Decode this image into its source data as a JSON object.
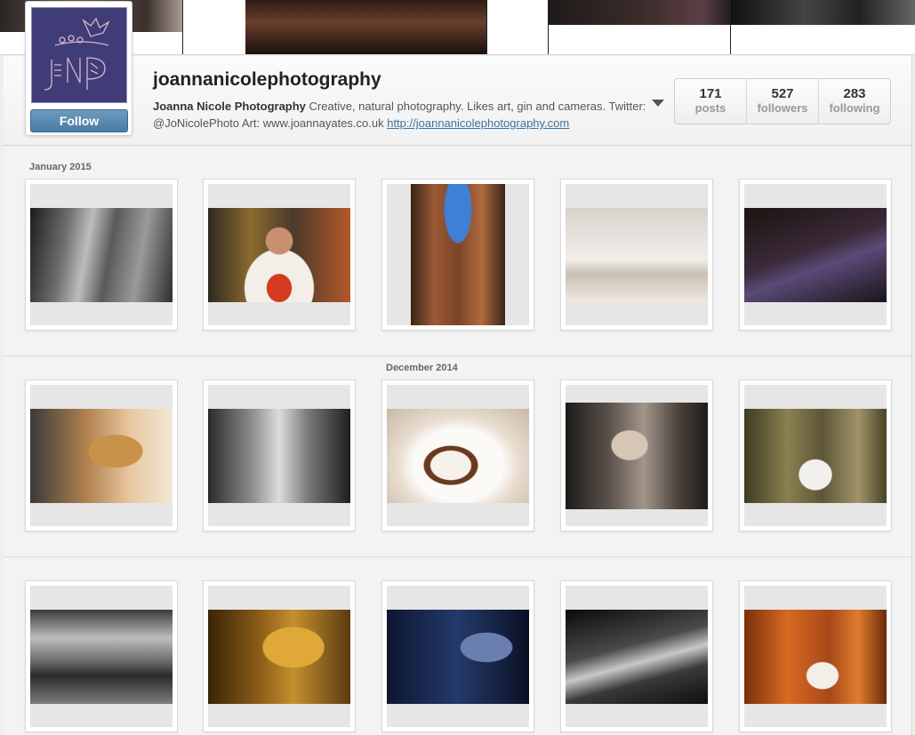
{
  "profile": {
    "username": "joannanicolephotography",
    "full_name": "Joanna Nicole Photography",
    "bio_text": " Creative, natural photography. Likes art, gin and cameras. Twitter: @JoNicolePhoto Art: www.joannayates.co.uk ",
    "website": "http://joannanicolephotography.com",
    "follow_label": "Follow",
    "avatar_text": "JNP",
    "stats": [
      {
        "number": "171",
        "label": "posts"
      },
      {
        "number": "527",
        "label": "followers"
      },
      {
        "number": "283",
        "label": "following"
      }
    ]
  },
  "feed": {
    "months": [
      "January 2015",
      "December 2014"
    ]
  },
  "colors": {
    "avatar_bg": "#3f3c78",
    "follow_button": "#4a7ba3",
    "link": "#3f729b"
  }
}
